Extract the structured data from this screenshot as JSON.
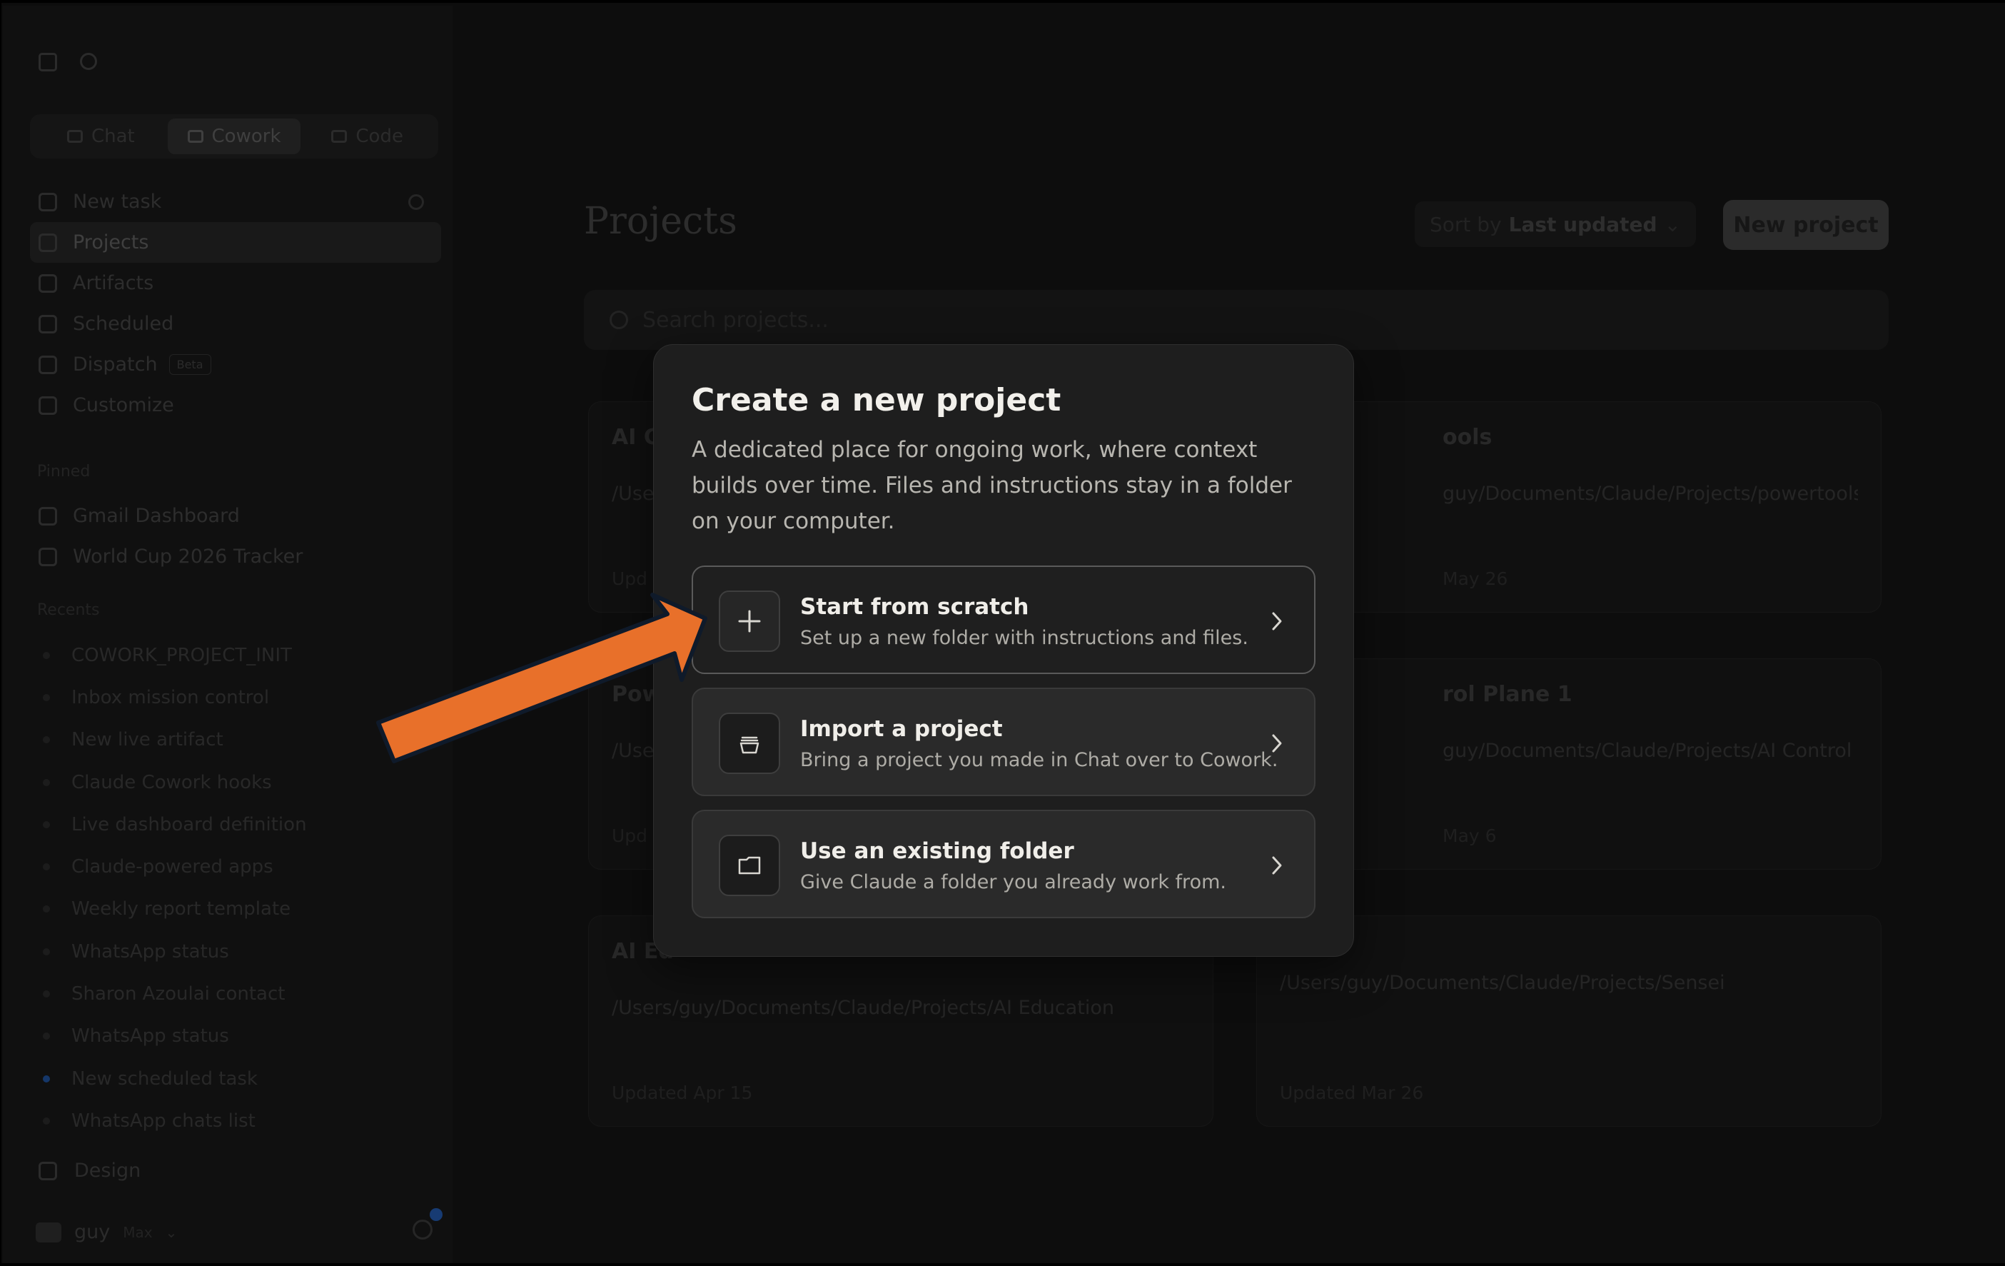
{
  "sidebar": {
    "modes": [
      {
        "label": "Chat",
        "active": false
      },
      {
        "label": "Cowork",
        "active": true
      },
      {
        "label": "Code",
        "active": false
      }
    ],
    "nav": [
      {
        "label": "New task",
        "icon": "plus-circle-icon",
        "active": false
      },
      {
        "label": "Projects",
        "icon": "folder-icon",
        "active": true
      },
      {
        "label": "Artifacts",
        "icon": "artifacts-icon",
        "active": false
      },
      {
        "label": "Scheduled",
        "icon": "clock-icon",
        "active": false
      },
      {
        "label": "Dispatch",
        "icon": "dispatch-icon",
        "active": false,
        "badge": "Beta"
      },
      {
        "label": "Customize",
        "icon": "customize-icon",
        "active": false
      }
    ],
    "pinned_label": "Pinned",
    "pinned": [
      "Gmail Dashboard",
      "World Cup 2026 Tracker"
    ],
    "recents_label": "Recents",
    "recents": [
      "COWORK_PROJECT_INIT",
      "Inbox mission control",
      "New live artifact",
      "Claude Cowork hooks",
      "Live dashboard definition",
      "Claude-powered apps",
      "Weekly report template",
      "WhatsApp status",
      "Sharon Azoulai contact",
      "WhatsApp status",
      "New scheduled task",
      "WhatsApp chats list"
    ],
    "design_label": "Design",
    "user_name": "guy",
    "user_plan": "Max"
  },
  "main": {
    "title": "Projects",
    "sort_prefix": "Sort by",
    "sort_value": "Last updated",
    "new_project_label": "New project",
    "search_placeholder": "Search projects...",
    "cards": [
      {
        "title": "AI C",
        "path": "/Use",
        "updated": "Upd"
      },
      {
        "title": "ools",
        "path": "guy/Documents/Claude/Projects/powertools",
        "updated": "May 26"
      },
      {
        "title": "Pow",
        "path": "/Use",
        "updated": "Upd"
      },
      {
        "title": "rol Plane 1",
        "path": "guy/Documents/Claude/Projects/AI Control",
        "updated": "May 6"
      },
      {
        "title": "AI Ed",
        "path": "/Users/guy/Documents/Claude/Projects/AI Education",
        "updated": "Updated Apr 15"
      },
      {
        "title": "",
        "path": "/Users/guy/Documents/Claude/Projects/Sensei",
        "updated": "Updated Mar 26"
      }
    ]
  },
  "modal": {
    "title": "Create a new project",
    "description": "A dedicated place for ongoing work, where context builds over time. Files and instructions stay in a folder on your computer.",
    "options": [
      {
        "title": "Start from scratch",
        "subtitle": "Set up a new folder with instructions and files.",
        "icon": "plus-icon"
      },
      {
        "title": "Import a project",
        "subtitle": "Bring a project you made in Chat over to Cowork.",
        "icon": "archive-icon"
      },
      {
        "title": "Use an existing folder",
        "subtitle": "Give Claude a folder you already work from.",
        "icon": "folder-icon"
      }
    ]
  },
  "colors": {
    "arrow": "#e8702a",
    "modal_bg": "#1e1e1e",
    "app_bg": "#121212"
  }
}
